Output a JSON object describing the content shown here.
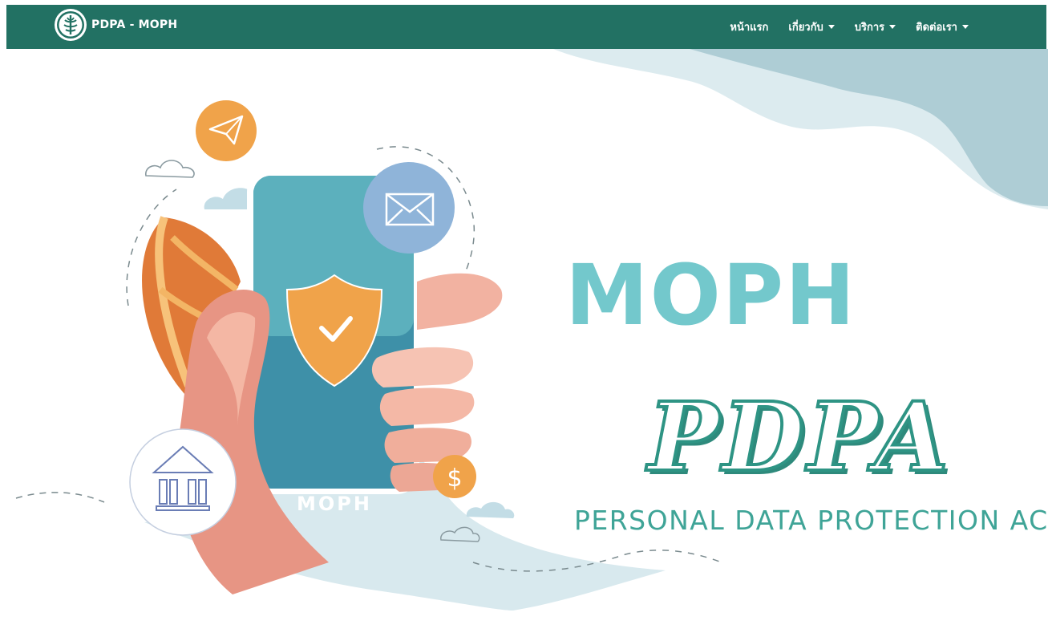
{
  "navbar": {
    "brand": "PDPA - MOPH",
    "logo_icon": "moph-emblem-icon",
    "background": "#227163",
    "items": [
      {
        "label": "หน้าแรก",
        "dropdown": false
      },
      {
        "label": "เกี่ยวกับ",
        "dropdown": true
      },
      {
        "label": "บริการ",
        "dropdown": true
      },
      {
        "label": "ติดต่อเรา",
        "dropdown": true
      }
    ]
  },
  "hero": {
    "title": "MOPH",
    "subtitle": "PDPA",
    "tagline": "PERSONAL DATA PROTECTION ACT",
    "phone_label": "MOPH",
    "colors": {
      "title": "#73c8cc",
      "pdpa": "#2e9484",
      "tagline": "#3fa497"
    },
    "icons": [
      "paper-plane-icon",
      "envelope-icon",
      "shield-check-icon",
      "bank-icon",
      "dollar-coin-icon",
      "cloud-icon",
      "leaf-icon",
      "hand-holding-phone-icon"
    ]
  }
}
